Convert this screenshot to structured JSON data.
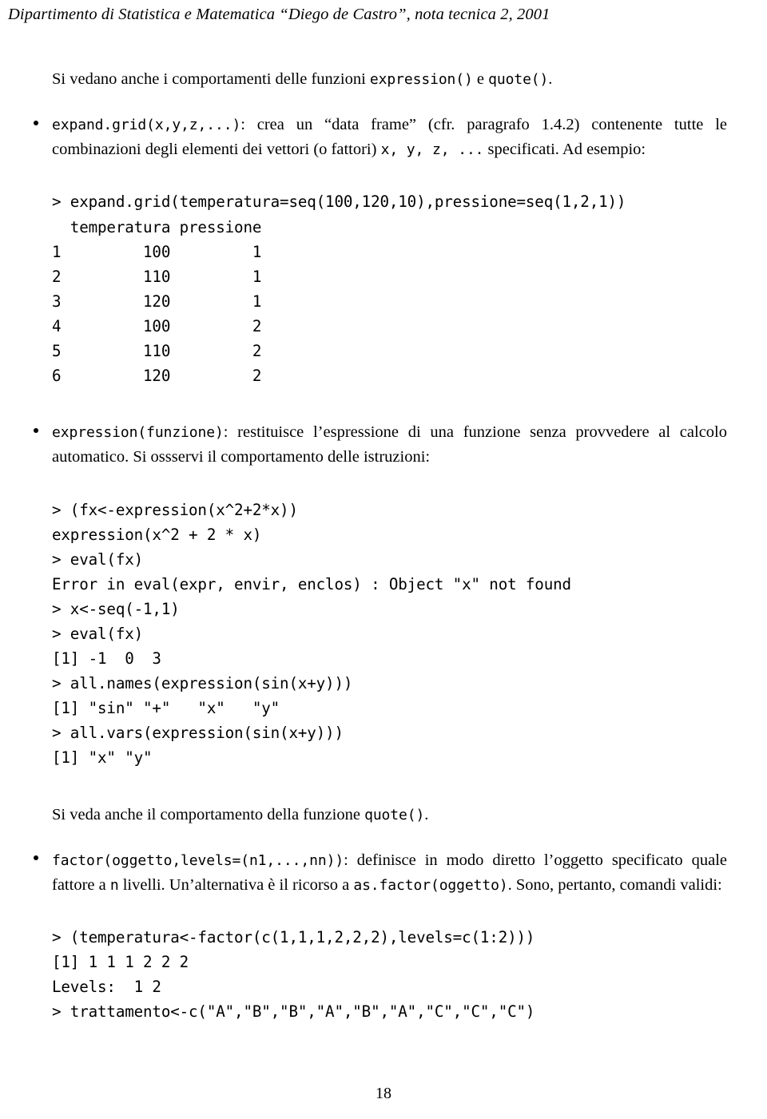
{
  "header": {
    "running_head": "Dipartimento di Statistica e Matematica “Diego de Castro”, nota tecnica 2, 2001"
  },
  "content": {
    "intro_paragraph": {
      "pre": "Si vedano anche i comportamenti delle funzioni ",
      "code1": "expression()",
      "mid": " e ",
      "code2": "quote()",
      "post": "."
    },
    "bullet_expand_grid": {
      "bullet_glyph": "•",
      "code_head": "expand.grid(x,y,z,...)",
      "text": ": crea un “data frame” (cfr. paragrafo 1.4.2) contenente tutte le combinazioni degli elementi dei vettori (o fattori) ",
      "code_vars": "x, y, z, ...",
      "text_tail": " specificati. Ad esempio:"
    },
    "code_block_expand_grid": "> expand.grid(temperatura=seq(100,120,10),pressione=seq(1,2,1))\n  temperatura pressione\n1         100         1\n2         110         1\n3         120         1\n4         100         2\n5         110         2\n6         120         2",
    "bullet_expression": {
      "bullet_glyph": "•",
      "code_head": "expression(funzione)",
      "text": ": restituisce l’espressione di una funzione senza provvedere al calcolo automatico. Si ossservi il comportamento delle istruzioni:"
    },
    "code_block_expression": "> (fx<-expression(x^2+2*x))\nexpression(x^2 + 2 * x)\n> eval(fx)\nError in eval(expr, envir, enclos) : Object \"x\" not found\n> x<-seq(-1,1)\n> eval(fx)\n[1] -1  0  3\n> all.names(expression(sin(x+y)))\n[1] \"sin\" \"+\"   \"x\"   \"y\"\n> all.vars(expression(sin(x+y)))\n[1] \"x\" \"y\"",
    "quote_paragraph": {
      "pre": "Si veda anche il comportamento della funzione ",
      "code1": "quote()",
      "post": "."
    },
    "bullet_factor": {
      "bullet_glyph": "•",
      "code_head": "factor(oggetto,levels=(n1,...,nn))",
      "text": ": definisce in modo diretto l’oggetto specificato quale fattore a ",
      "code_n": "n",
      "text2": " livelli. Un’alternativa è il ricorso a ",
      "code_asfactor": "as.factor(oggetto)",
      "text3": ". Sono, pertanto, comandi validi:"
    },
    "code_block_factor": "> (temperatura<-factor(c(1,1,1,2,2,2),levels=c(1:2)))\n[1] 1 1 1 2 2 2\nLevels:  1 2\n> trattamento<-c(\"A\",\"B\",\"B\",\"A\",\"B\",\"A\",\"C\",\"C\",\"C\")"
  },
  "footer": {
    "page_number": "18"
  }
}
